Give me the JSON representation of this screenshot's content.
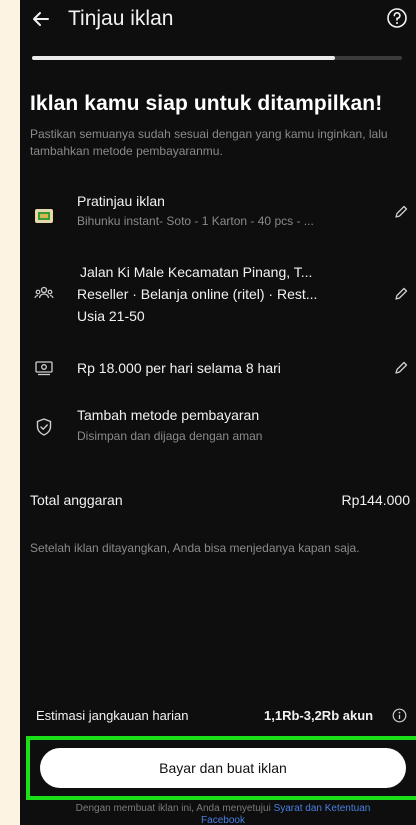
{
  "header": {
    "title": "Tinjau iklan"
  },
  "progress": {
    "fraction": 0.82
  },
  "main": {
    "headline": "Iklan kamu siap untuk ditampilkan!",
    "subtitle": "Pastikan semuanya sudah sesuai dengan yang kamu inginkan, lalu tambahkan metode pembayaranmu."
  },
  "rows": {
    "preview": {
      "title": "Pratinjau iklan",
      "sub": "Bihunku instant- Soto - 1 Karton - 40 pcs - ..."
    },
    "audience": {
      "line1": "Jalan Ki Male Kecamatan Pinang, T...",
      "line2": "Reseller · Belanja online (ritel) · Rest...",
      "line3": "Usia 21-50"
    },
    "budget": {
      "title": "Rp 18.000 per hari selama 8 hari"
    },
    "payment": {
      "title": "Tambah metode pembayaran",
      "sub": "Disimpan dan dijaga dengan aman"
    }
  },
  "total": {
    "label": "Total anggaran",
    "value": "Rp144.000"
  },
  "note": "Setelah iklan ditayangkan, Anda bisa menjedanya kapan saja.",
  "reach": {
    "label": "Estimasi jangkauan harian",
    "value": "1,1Rb-3,2Rb akun"
  },
  "cta": {
    "label": "Bayar dan buat iklan"
  },
  "legal": {
    "prefix": "Dengan membuat iklan ini, Anda menyetujui",
    "link": "Syarat dan Ketentuan",
    "suffix": "Facebook"
  },
  "colors": {
    "highlight": "#19e019",
    "background": "#0e0e0f",
    "link": "#4a7fe0"
  }
}
